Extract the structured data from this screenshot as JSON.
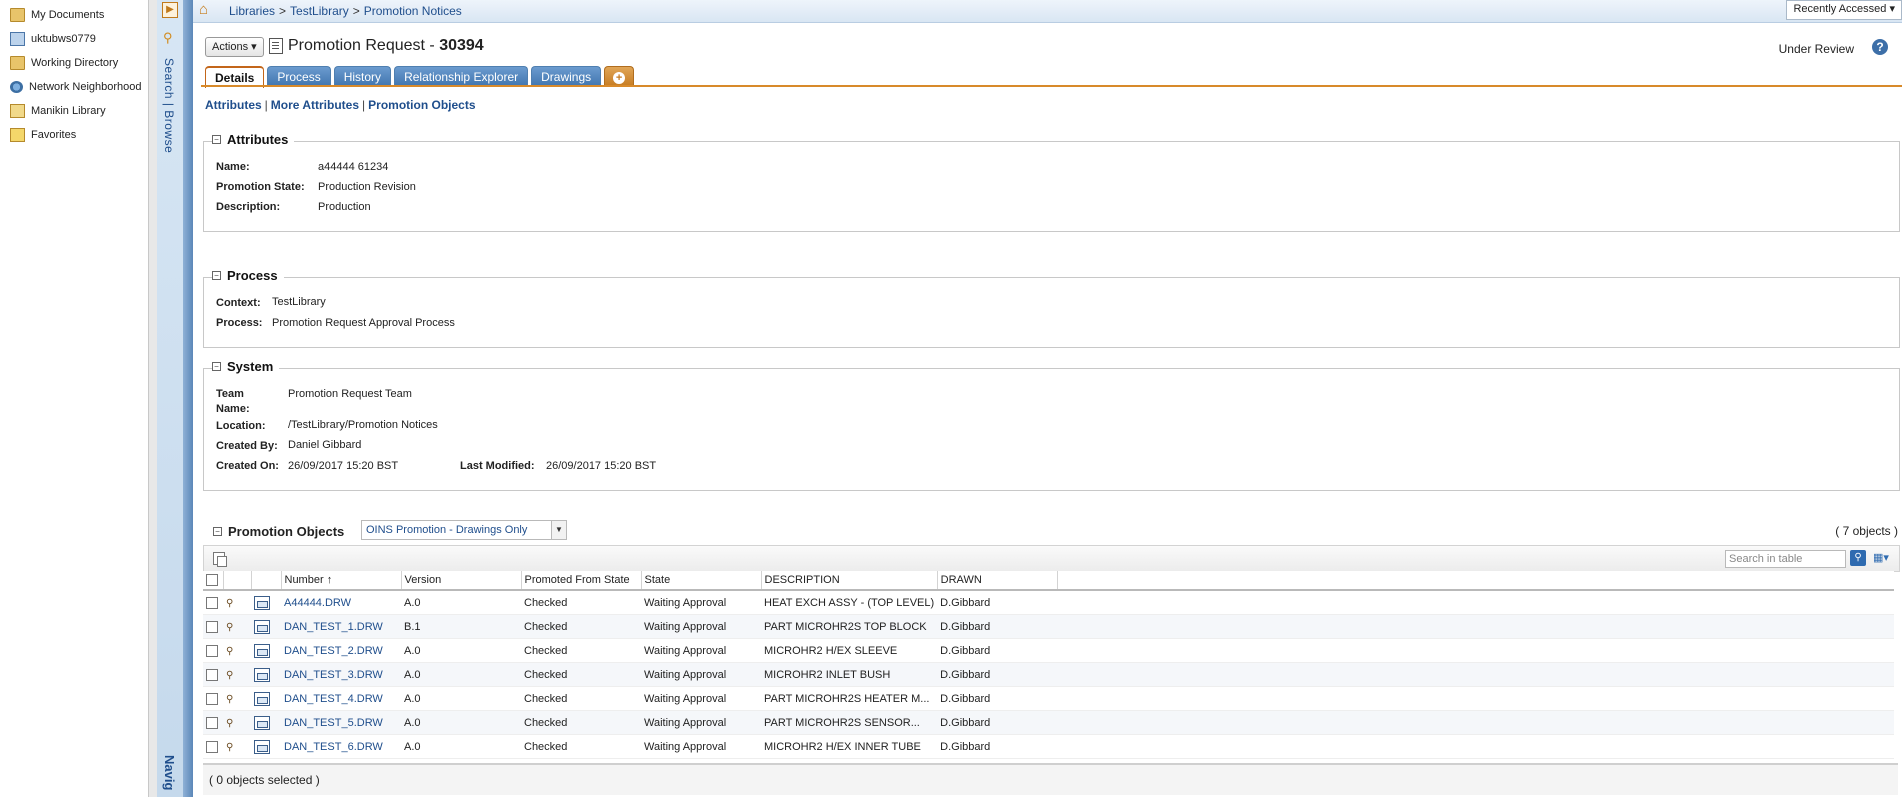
{
  "navigator": {
    "items": [
      {
        "label": "My Documents",
        "icon": "folder-icon"
      },
      {
        "label": "uktubws0779",
        "icon": "computer-icon"
      },
      {
        "label": "Working Directory",
        "icon": "folder-icon"
      },
      {
        "label": "Network Neighborhood",
        "icon": "network-icon"
      },
      {
        "label": "Manikin Library",
        "icon": "library-icon"
      },
      {
        "label": "Favorites",
        "icon": "favorites-icon"
      }
    ],
    "vertical_tabs": "Search | Browse",
    "bottom_label": "Navig"
  },
  "breadcrumb": {
    "items": [
      "Libraries",
      "TestLibrary",
      "Promotion Notices"
    ],
    "recently_accessed": "Recently Accessed"
  },
  "header": {
    "actions_label": "Actions",
    "title_prefix": "Promotion Request - ",
    "title_number": "30394",
    "status": "Under Review"
  },
  "tabs": [
    "Details",
    "Process",
    "History",
    "Relationship Explorer",
    "Drawings"
  ],
  "sublinks": [
    "Attributes",
    "More Attributes",
    "Promotion Objects"
  ],
  "attributes": {
    "heading": "Attributes",
    "name_label": "Name:",
    "name": "a44444 61234",
    "state_label": "Promotion State:",
    "state": "Production Revision",
    "desc_label": "Description:",
    "description": "Production"
  },
  "process": {
    "heading": "Process",
    "context_label": "Context:",
    "context": "TestLibrary",
    "process_label": "Process:",
    "process": "Promotion Request Approval Process"
  },
  "system": {
    "heading": "System",
    "team_label_1": "Team",
    "team_label_2": "Name:",
    "team": "Promotion Request Team",
    "location_label": "Location:",
    "location": "/TestLibrary/Promotion Notices",
    "created_by_label": "Created By:",
    "created_by": "Daniel Gibbard",
    "created_on_label": "Created On:",
    "created_on": "26/09/2017 15:20 BST",
    "modified_label": "Last Modified:",
    "modified": "26/09/2017 15:20 BST"
  },
  "promotion_objects": {
    "heading": "Promotion Objects",
    "filter": "OINS Promotion - Drawings Only",
    "count": "( 7 objects )",
    "search_placeholder": "Search in table",
    "columns": [
      "Number",
      "Version",
      "Promoted From State",
      "State",
      "DESCRIPTION",
      "DRAWN"
    ],
    "sort_indicator": "↑",
    "rows": [
      {
        "number": "A44444.DRW",
        "version": "A.0",
        "from_state": "Checked",
        "state": "Waiting Approval",
        "description": "HEAT EXCH ASSY - (TOP LEVEL)",
        "drawn": "D.Gibbard"
      },
      {
        "number": "DAN_TEST_1.DRW",
        "version": "B.1",
        "from_state": "Checked",
        "state": "Waiting Approval",
        "description": "PART MICROHR2S TOP BLOCK",
        "drawn": "D.Gibbard"
      },
      {
        "number": "DAN_TEST_2.DRW",
        "version": "A.0",
        "from_state": "Checked",
        "state": "Waiting Approval",
        "description": "MICROHR2 H/EX  SLEEVE",
        "drawn": "D.Gibbard"
      },
      {
        "number": "DAN_TEST_3.DRW",
        "version": "A.0",
        "from_state": "Checked",
        "state": "Waiting Approval",
        "description": "MICROHR2 INLET BUSH",
        "drawn": "D.Gibbard"
      },
      {
        "number": "DAN_TEST_4.DRW",
        "version": "A.0",
        "from_state": "Checked",
        "state": "Waiting Approval",
        "description": "PART MICROHR2S HEATER M...",
        "drawn": "D.Gibbard"
      },
      {
        "number": "DAN_TEST_5.DRW",
        "version": "A.0",
        "from_state": "Checked",
        "state": "Waiting Approval",
        "description": "PART MICROHR2S SENSOR...",
        "drawn": "D.Gibbard"
      },
      {
        "number": "DAN_TEST_6.DRW",
        "version": "A.0",
        "from_state": "Checked",
        "state": "Waiting Approval",
        "description": "MICROHR2 H/EX INNER TUBE",
        "drawn": "D.Gibbard"
      }
    ],
    "selected_status": "( 0 objects selected )"
  }
}
